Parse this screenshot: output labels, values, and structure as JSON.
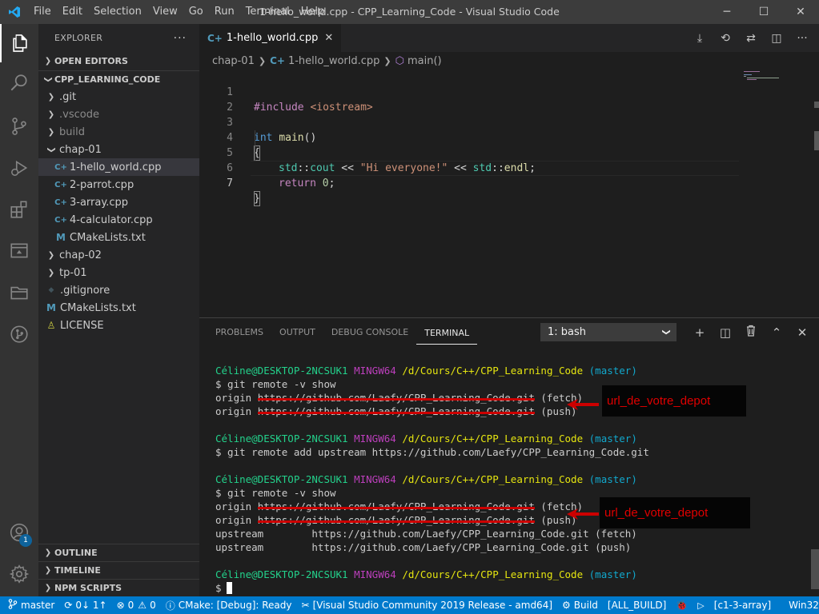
{
  "titlebar": {
    "menu": [
      "File",
      "Edit",
      "Selection",
      "View",
      "Go",
      "Run",
      "Terminal",
      "Help"
    ],
    "title": "1-hello_world.cpp - CPP_Learning_Code - Visual Studio Code",
    "controls": {
      "minimize": "─",
      "maximize": "☐",
      "close": "✕"
    }
  },
  "activity": {
    "accounts_badge": "1"
  },
  "sidebar": {
    "header": "EXPLORER",
    "more": "···",
    "open_editors": "OPEN EDITORS",
    "workspace": "CPP_LEARNING_CODE",
    "tree": [
      {
        "label": ".git",
        "type": "folder",
        "depth": 1,
        "expanded": false,
        "dim": false
      },
      {
        "label": ".vscode",
        "type": "folder",
        "depth": 1,
        "expanded": false,
        "dim": true
      },
      {
        "label": "build",
        "type": "folder",
        "depth": 1,
        "expanded": false,
        "dim": true
      },
      {
        "label": "chap-01",
        "type": "folder",
        "depth": 1,
        "expanded": true,
        "dim": false
      },
      {
        "label": "1-hello_world.cpp",
        "type": "cpp",
        "depth": 2,
        "selected": true
      },
      {
        "label": "2-parrot.cpp",
        "type": "cpp",
        "depth": 2
      },
      {
        "label": "3-array.cpp",
        "type": "cpp",
        "depth": 2
      },
      {
        "label": "4-calculator.cpp",
        "type": "cpp",
        "depth": 2
      },
      {
        "label": "CMakeLists.txt",
        "type": "cmake",
        "depth": 2
      },
      {
        "label": "chap-02",
        "type": "folder",
        "depth": 1,
        "expanded": false
      },
      {
        "label": "tp-01",
        "type": "folder",
        "depth": 1,
        "expanded": false
      },
      {
        "label": ".gitignore",
        "type": "gitignore",
        "depth": 1
      },
      {
        "label": "CMakeLists.txt",
        "type": "cmake",
        "depth": 1
      },
      {
        "label": "LICENSE",
        "type": "license",
        "depth": 1
      }
    ],
    "outline": "OUTLINE",
    "timeline": "TIMELINE",
    "npm_scripts": "NPM SCRIPTS"
  },
  "editor": {
    "tab": {
      "label": "1-hello_world.cpp",
      "icon": "C+",
      "close": "✕"
    },
    "breadcrumb": {
      "folder": "chap-01",
      "file": "1-hello_world.cpp",
      "symbol": "main()"
    },
    "line_numbers": [
      "1",
      "2",
      "3",
      "4",
      "5",
      "6",
      "7"
    ],
    "code": {
      "l1_pp": "#include",
      "l1_inc": "<iostream>",
      "l3_kw": "int",
      "l3_fn": "main",
      "l3_rest": "()",
      "l4": "{",
      "l5_ns1": "std",
      "l5_op1": "::",
      "l5_cout": "cout",
      "l5_op2": " << ",
      "l5_str": "\"Hi everyone!\"",
      "l5_op3": " << ",
      "l5_ns2": "std",
      "l5_op4": "::",
      "l5_endl": "endl",
      "l5_end": ";",
      "l6_kw": "return",
      "l6_num": "0",
      "l6_end": ";",
      "l7": "}"
    }
  },
  "panel": {
    "tabs": [
      "PROBLEMS",
      "OUTPUT",
      "DEBUG CONSOLE",
      "TERMINAL"
    ],
    "active_tab": "TERMINAL",
    "terminal_select": "1: bash",
    "actions": {
      "add": "+",
      "split": "◫",
      "trash": "🗑",
      "maximize": "⌃",
      "close": "✕"
    }
  },
  "terminal": {
    "prompt_user": "Céline@DESKTOP-2NCSUK1",
    "prompt_env": "MINGW64",
    "prompt_path": "/d/Cours/C++/CPP_Learning_Code",
    "prompt_branch": "(master)",
    "cmd1": "$ git remote -v show",
    "origin": "origin",
    "url_struck": "https://github.com/Laefy/CPP_Learning_Code.git",
    "fetch": "(fetch)",
    "push": "(push)",
    "cmd2": "$ git remote add upstream https://github.com/Laefy/CPP_Learning_Code.git",
    "cmd3": "$ git remote -v show",
    "upstream_fetch": "upstream        https://github.com/Laefy/CPP_Learning_Code.git (fetch)",
    "upstream_push": "upstream        https://github.com/Laefy/CPP_Learning_Code.git (push)",
    "final_prompt": "$",
    "annotation": "url_de_votre_depot"
  },
  "statusbar": {
    "branch": "master",
    "sync": "0↓ 1↑",
    "errors": "0",
    "warnings": "0",
    "cmake": "CMake: [Debug]: Ready",
    "kit": "[Visual Studio Community 2019 Release - amd64]",
    "build": "Build",
    "target": "[ALL_BUILD]",
    "run_target": "[c1-3-array]",
    "platform": "Win32"
  },
  "colors": {
    "accent": "#007acc",
    "annotation_red": "#e00000"
  }
}
